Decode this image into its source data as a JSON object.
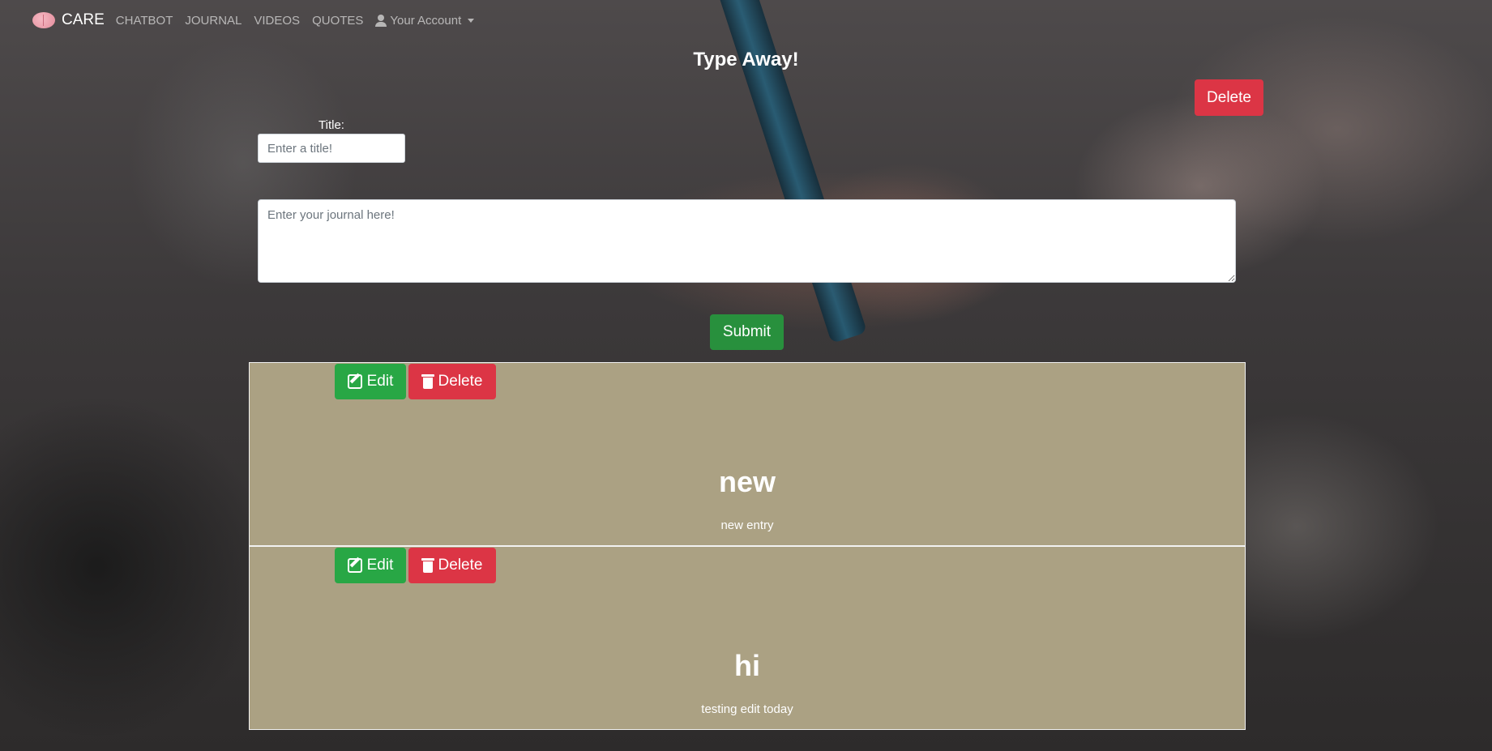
{
  "nav": {
    "brand": "CARE",
    "links": [
      "CHATBOT",
      "JOURNAL",
      "VIDEOS",
      "QUOTES"
    ],
    "account": "Your Account"
  },
  "page": {
    "title": "Type Away!",
    "delete_label": "Delete"
  },
  "form": {
    "title_label": "Title:",
    "title_placeholder": "Enter a title!",
    "journal_placeholder": "Enter your journal here!",
    "submit_label": "Submit"
  },
  "entries": [
    {
      "title": "new",
      "body": "new entry",
      "edit_label": "Edit",
      "delete_label": "Delete"
    },
    {
      "title": "hi",
      "body": "testing edit today",
      "edit_label": "Edit",
      "delete_label": "Delete"
    }
  ],
  "colors": {
    "delete": "#dc3545",
    "edit": "#28a745",
    "submit": "#28903d",
    "entry_bg": "#aba183"
  }
}
